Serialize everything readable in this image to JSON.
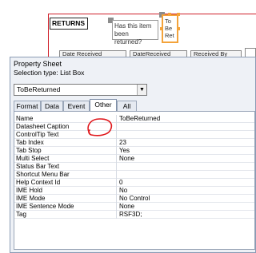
{
  "form": {
    "returns_label": "RETURNS",
    "question_label_line1": "Has this item",
    "question_label_line2": "been returned?",
    "listbox_text_line1": "To",
    "listbox_text_line2": "Be",
    "listbox_text_line3": "Ret",
    "fields": [
      "Date Received",
      "DateReceived",
      "Received By"
    ]
  },
  "property_sheet": {
    "title": "Property Sheet",
    "selection_type": "Selection type:  List Box",
    "selected_object": "ToBeReturned",
    "tabs": [
      {
        "label": "Format"
      },
      {
        "label": "Data"
      },
      {
        "label": "Event"
      },
      {
        "label": "Other",
        "active": true
      },
      {
        "label": "All"
      }
    ],
    "properties": [
      {
        "name": "Name",
        "value": "ToBeReturned"
      },
      {
        "name": "Datasheet Caption",
        "value": ""
      },
      {
        "name": "ControlTip Text",
        "value": ""
      },
      {
        "name": "Tab Index",
        "value": "23"
      },
      {
        "name": "Tab Stop",
        "value": "Yes"
      },
      {
        "name": "Multi Select",
        "value": "None"
      },
      {
        "name": "Status Bar Text",
        "value": ""
      },
      {
        "name": "Shortcut Menu Bar",
        "value": ""
      },
      {
        "name": "Help Context Id",
        "value": "0"
      },
      {
        "name": "IME Hold",
        "value": "No"
      },
      {
        "name": "IME Mode",
        "value": "No Control"
      },
      {
        "name": "IME Sentence Mode",
        "value": "None"
      },
      {
        "name": "Tag",
        "value": "RSF3D;"
      }
    ]
  },
  "colors": {
    "annotation": "#e0181c",
    "selection_border": "#f3a33b"
  },
  "icons": {
    "dropdown": "chevron-down-icon"
  }
}
